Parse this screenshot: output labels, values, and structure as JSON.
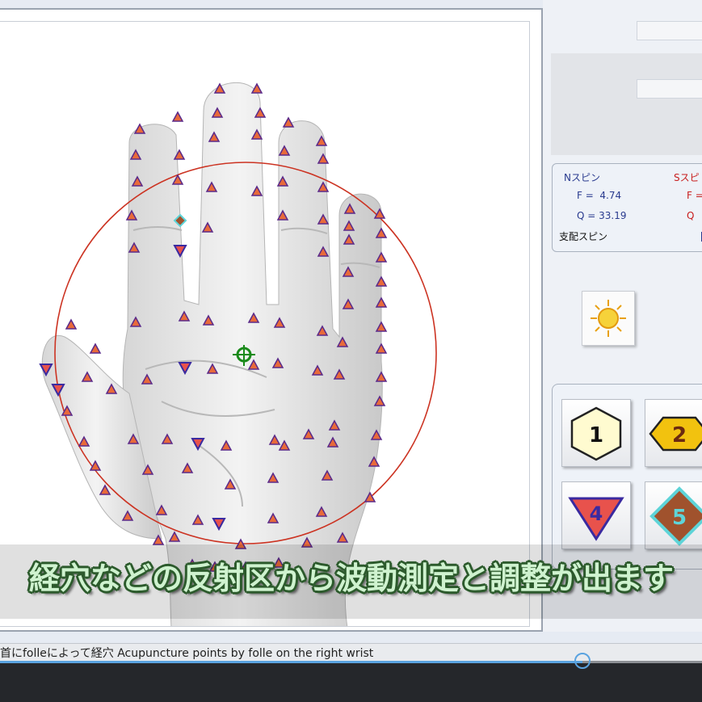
{
  "spin_panel": {
    "n_spin_label": "Nスピン",
    "s_spin_label": "Sスピ",
    "n_f": "F =  4.74",
    "n_q": "Q = 33.19",
    "s_f": "F =",
    "s_q": "Q",
    "dominant_label": "支配スピン"
  },
  "buttons": [
    {
      "label": "1",
      "shape": "hexagon",
      "color": "#fffbd0"
    },
    {
      "label": "2",
      "shape": "hexagon",
      "color": "#f2c20f"
    },
    {
      "label": "4",
      "shape": "triangle-down",
      "color": "#e8524c"
    },
    {
      "label": "5",
      "shape": "diamond",
      "color": "#a0522d"
    }
  ],
  "caption": "経穴などの反射区から波動測定と調整が出ます",
  "status_text": "首にfolleによって経穴 Acupuncture points by folle on the right wrist",
  "progress": 0.83,
  "colors": {
    "point_fill": "#e86a3a",
    "point_border": "#5a2a8a",
    "circle": "#cc3322",
    "marker_green": "#1a8a1a"
  },
  "icons": [
    "sun-icon",
    "target-icon"
  ]
}
